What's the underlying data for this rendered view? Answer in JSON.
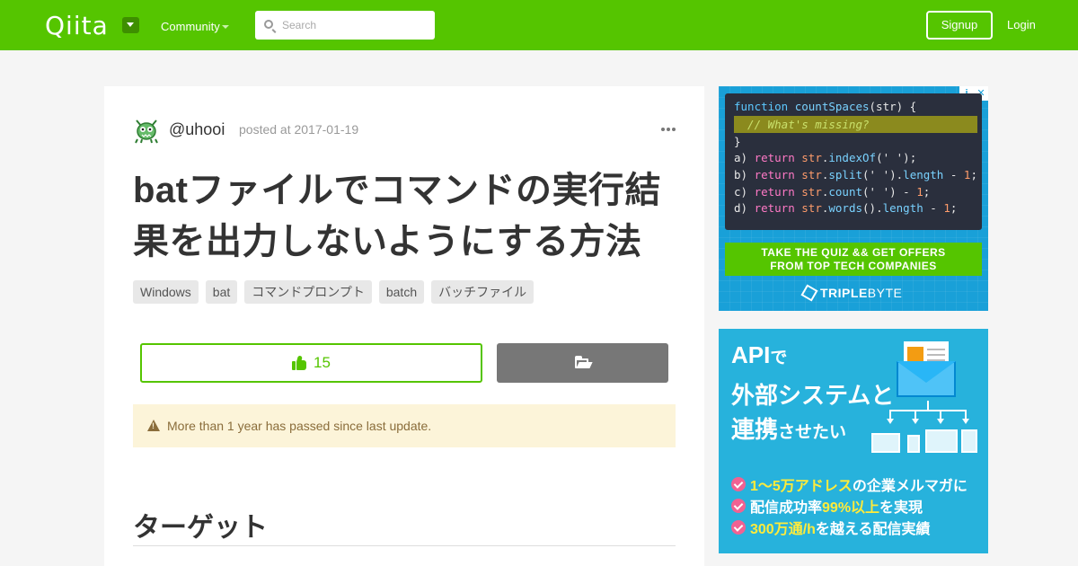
{
  "header": {
    "logo_text": "Qiita",
    "community_label": "Community",
    "search_placeholder": "Search",
    "signup_label": "Signup",
    "login_label": "Login",
    "brand_color": "#55c500"
  },
  "article": {
    "username": "@uhooi",
    "posted": "posted at 2017-01-19",
    "title": "batファイルでコマンドの実行結果を出力しないようにする方法",
    "tags": [
      "Windows",
      "bat",
      "コマンドプロンプト",
      "batch",
      "バッチファイル"
    ],
    "like_count": "15",
    "warning": "More than 1 year has passed since last update.",
    "section_heading": "ターゲット"
  },
  "ad_tripleplebyte": {
    "adchoices_info": "i",
    "adchoices_close": "✕",
    "code_lines": [
      "function countSpaces(str) {",
      "  // What's missing?",
      "}",
      "a) return str.indexOf(' ');",
      "b) return str.split(' ').length - 1;",
      "c) return str.count(' ') - 1;",
      "d) return str.words().length - 1;"
    ],
    "band_line1": "TAKE THE QUIZ && GET OFFERS",
    "band_line2": "FROM TOP TECH COMPANIES",
    "logo_part1": "TRIPLE",
    "logo_part2": "BYTE"
  },
  "ad_api": {
    "title_line1_main": "API",
    "title_line1_small": "で",
    "title_line2": "外部システムと",
    "title_line3_main": "連携",
    "title_line3_small": "させたい",
    "bullets": [
      {
        "highlight": "1〜5万アドレス",
        "rest": "の企業メルマガに"
      },
      {
        "prefix": "配信成功率",
        "highlight": "99%以上",
        "rest": "を実現"
      },
      {
        "highlight": "300万通/h",
        "rest": "を越える配信実績"
      }
    ]
  }
}
